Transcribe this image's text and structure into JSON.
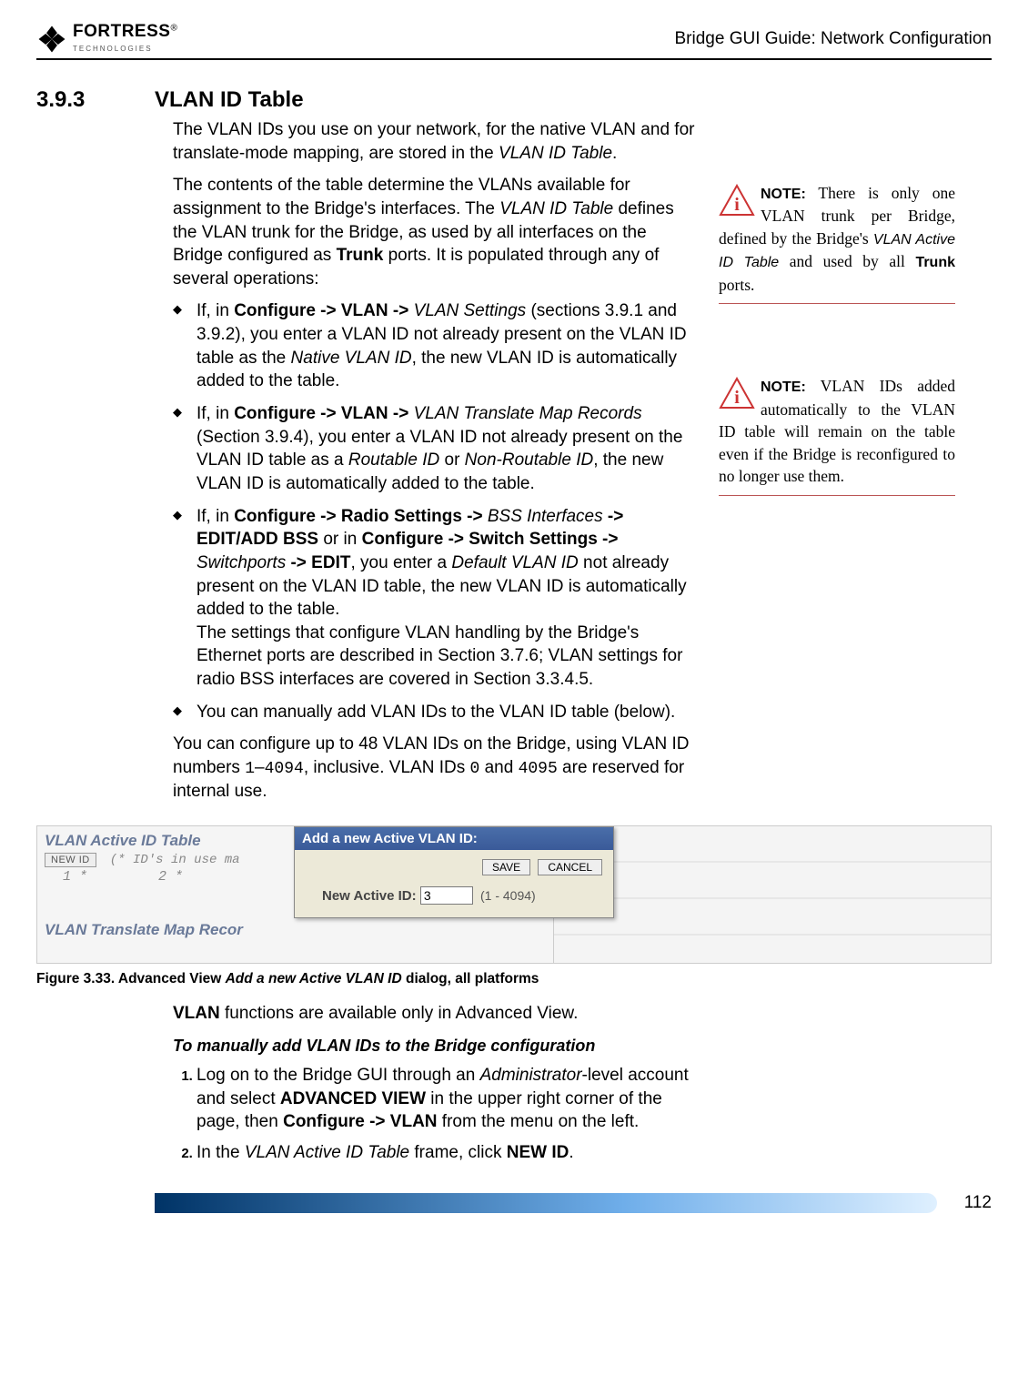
{
  "header": {
    "logo_main": "FORTRESS",
    "logo_sub": "TECHNOLOGIES",
    "reg": "®",
    "title": "Bridge GUI Guide: Network Configuration"
  },
  "section": {
    "number": "3.9.3",
    "title": "VLAN ID Table"
  },
  "body": {
    "p1a": "The VLAN IDs you use on your network, for the native VLAN and for translate-mode mapping, are stored in the ",
    "p1b": "VLAN ID Table",
    "p1c": ".",
    "p2a": "The contents of the table determine the VLANs available for assignment to the Bridge's interfaces. The ",
    "p2b": "VLAN ID Table",
    "p2c": " defines the VLAN trunk for the Bridge, as used by all interfaces on the Bridge configured as ",
    "p2d": "Trunk",
    "p2e": " ports. It is populated through any of several operations:",
    "b1a": "If, in ",
    "b1b": "Configure -> VLAN -> ",
    "b1c": "VLAN Settings",
    "b1d": " (sections 3.9.1 and 3.9.2), you enter a VLAN ID not already present on the VLAN ID table as the ",
    "b1e": "Native VLAN ID",
    "b1f": ", the new VLAN ID is automatically added to the table.",
    "b2a": "If, in ",
    "b2b": "Configure -> VLAN -> ",
    "b2c": "VLAN Translate Map Records",
    "b2d": " (Section 3.9.4), you enter a VLAN ID not already present on the VLAN ID table as a ",
    "b2e": "Routable ID",
    "b2f": " or ",
    "b2g": "Non-Routable ID",
    "b2h": ", the new VLAN ID is automatically added to the table.",
    "b3a": "If, in ",
    "b3b": "Configure -> Radio Settings -> ",
    "b3c": "BSS Interfaces",
    "b3d": " -> EDIT/ADD BSS",
    "b3e": " or in ",
    "b3f": "Configure -> Switch Settings -> ",
    "b3g": "Switchports",
    "b3h": " -> EDIT",
    "b3i": ", you enter a ",
    "b3j": "Default VLAN ID",
    "b3k": " not already present on the VLAN ID table, the new VLAN ID is automatically added to the table.",
    "b3sub": "The settings that configure VLAN handling by the Bridge's Ethernet ports are described in Section 3.7.6; VLAN settings for radio BSS interfaces are covered in Section 3.3.4.5.",
    "b4": "You can manually add VLAN IDs to the VLAN ID table (below).",
    "p3a": "You can configure up to 48 VLAN IDs on the Bridge, using VLAN ID numbers ",
    "p3b": "1",
    "p3c": "–",
    "p3d": "4094",
    "p3e": ", inclusive. VLAN IDs ",
    "p3f": "0",
    "p3g": " and ",
    "p3h": "4095",
    "p3i": " are reserved for internal use.",
    "p4a": "VLAN",
    "p4b": " functions are available only in Advanced View.",
    "proc": "To manually add VLAN IDs to the Bridge configuration",
    "s1a": "Log on to the Bridge GUI through an ",
    "s1b": "Administrator",
    "s1c": "-level account and select ",
    "s1d": "ADVANCED VIEW",
    "s1e": " in the upper right corner of the page, then ",
    "s1f": "Configure -> VLAN",
    "s1g": " from the menu on the left.",
    "s2a": "In the ",
    "s2b": "VLAN Active ID Table",
    "s2c": " frame, click ",
    "s2d": "NEW ID",
    "s2e": "."
  },
  "notes": {
    "n1": {
      "label": "NOTE:",
      "text1": " There is only one VLAN trunk per Bridge, defined by the Bridge's ",
      "text2": "VLAN Active ID Table",
      "text3": " and used by all ",
      "text4": "Trunk",
      "text5": " ports."
    },
    "n2": {
      "label": "NOTE:",
      "text": " VLAN IDs added automatically to the VLAN ID table will remain on the table even if the Bridge is reconfigured to no longer use them."
    }
  },
  "figure": {
    "left_title": "VLAN Active ID Table",
    "newid_btn": "NEW ID",
    "ids_hint": "(* ID's in use ma",
    "row_a": "1 *",
    "row_b": "2 *",
    "left_bottom": "VLAN Translate Map Recor",
    "dialog_title": "Add a new Active VLAN ID:",
    "save": "SAVE",
    "cancel": "CANCEL",
    "field_label": "New Active ID:",
    "field_value": "3",
    "range": "(1 - 4094)",
    "caption_a": "Figure 3.33. Advanced View ",
    "caption_b": "Add a new Active VLAN ID",
    "caption_c": " dialog, all platforms"
  },
  "footer": {
    "page": "112"
  }
}
